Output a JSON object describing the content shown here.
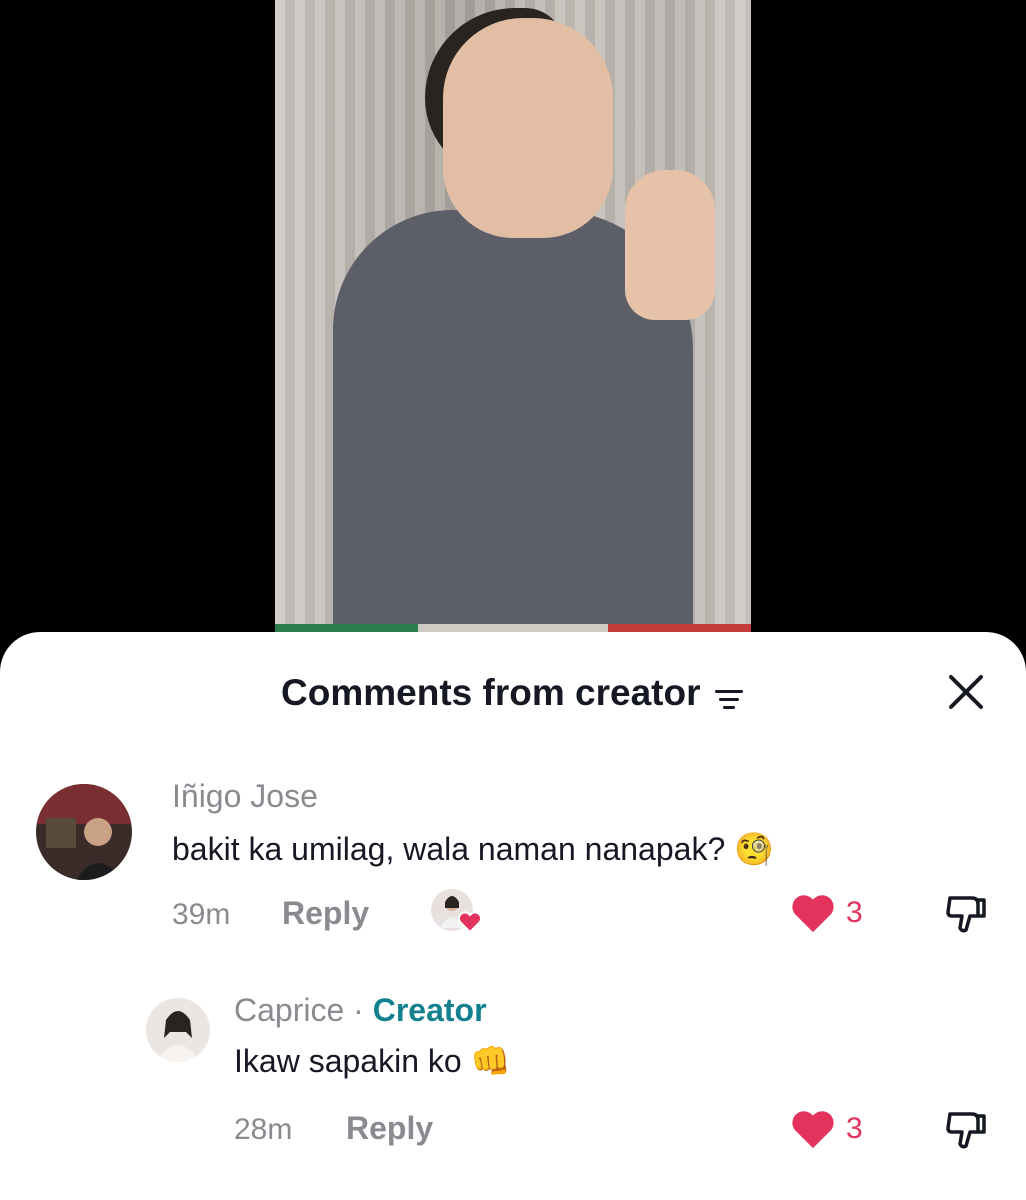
{
  "video": {
    "description_icon": "video-frame"
  },
  "sheet": {
    "title": "Comments from creator",
    "filter_icon": "filter-icon",
    "close_icon": "close-icon"
  },
  "comments": [
    {
      "username": "Iñigo Jose",
      "text": "bakit ka umilag, wala naman nanapak?",
      "emoji": "🧐",
      "time": "39m",
      "reply_label": "Reply",
      "likes": "3",
      "liked_by_creator": true
    }
  ],
  "replies": [
    {
      "username": "Caprice",
      "separator": " · ",
      "badge": "Creator",
      "text": "Ikaw sapakin ko",
      "emoji": "👊",
      "time": "28m",
      "reply_label": "Reply",
      "likes": "3"
    }
  ],
  "colors": {
    "like": "#e3335d",
    "creator_badge": "#13808f",
    "text_primary": "#161823",
    "text_secondary": "#8a8b91"
  }
}
